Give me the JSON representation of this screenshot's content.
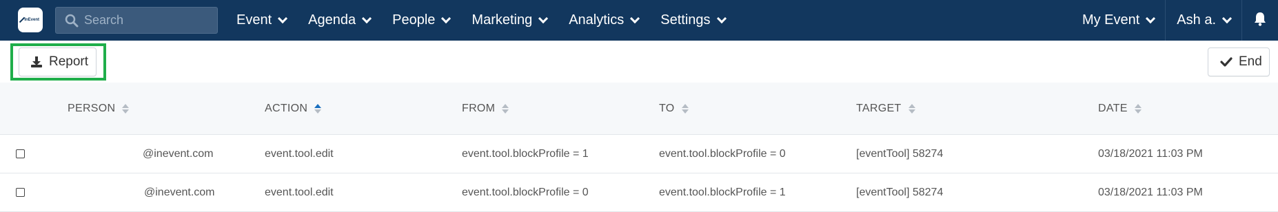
{
  "app": {
    "logo_icon": "inevent-logo",
    "logo_text": "InEvent"
  },
  "search": {
    "placeholder": "Search",
    "value": ""
  },
  "nav": {
    "items": [
      {
        "label": "Event"
      },
      {
        "label": "Agenda"
      },
      {
        "label": "People"
      },
      {
        "label": "Marketing"
      },
      {
        "label": "Analytics"
      },
      {
        "label": "Settings"
      }
    ],
    "right": {
      "event_menu": "My Event",
      "user_menu": "Ash a.",
      "notification_icon": "bell-icon"
    }
  },
  "toolbar": {
    "report_label": "Report",
    "report_icon": "download-icon",
    "end_label": "End",
    "end_icon": "check-icon"
  },
  "colors": {
    "nav_bg": "#12375e",
    "highlight": "#1fae4a",
    "sort_active": "#1a6fbf"
  },
  "table": {
    "columns": [
      {
        "key": "person",
        "label": "PERSON",
        "sort": "none"
      },
      {
        "key": "action",
        "label": "ACTION",
        "sort": "asc"
      },
      {
        "key": "from",
        "label": "FROM",
        "sort": "none"
      },
      {
        "key": "to",
        "label": "TO",
        "sort": "none"
      },
      {
        "key": "target",
        "label": "TARGET",
        "sort": "none"
      },
      {
        "key": "date",
        "label": "DATE",
        "sort": "none"
      }
    ],
    "rows": [
      {
        "person": "@inevent.com",
        "action": "event.tool.edit",
        "from": "event.tool.blockProfile = 1",
        "to": "event.tool.blockProfile = 0",
        "target": "[eventTool] 58274",
        "date": "03/18/2021 11:03 PM"
      },
      {
        "person": "@inevent.com",
        "action": "event.tool.edit",
        "from": "event.tool.blockProfile = 0",
        "to": "event.tool.blockProfile = 1",
        "target": "[eventTool] 58274",
        "date": "03/18/2021 11:03 PM"
      }
    ]
  }
}
